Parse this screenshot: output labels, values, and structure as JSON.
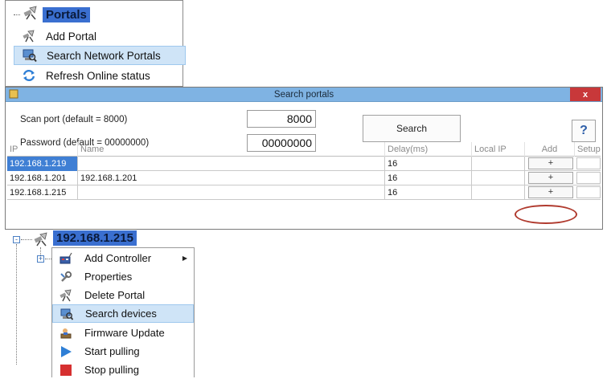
{
  "portals_menu": {
    "title": "Portals",
    "items": [
      {
        "label": "Add Portal",
        "icon": "satellite-icon"
      },
      {
        "label": "Search Network Portals",
        "icon": "search-network-icon"
      },
      {
        "label": "Refresh Online status",
        "icon": "refresh-icon"
      }
    ],
    "highlighted_index": 1
  },
  "dialog": {
    "title": "Search portals",
    "close_label": "x",
    "scan_port_label": "Scan port (default = 8000)",
    "scan_port_value": "8000",
    "password_label": "Password (default = 00000000)",
    "password_value": "00000000",
    "search_button": "Search",
    "help_button": "?",
    "table": {
      "columns": [
        "IP",
        "Name",
        "Delay(ms)",
        "Local IP",
        "Add",
        "Setup"
      ],
      "rows": [
        {
          "ip": "192.168.1.219",
          "name": "",
          "delay": "16",
          "local_ip": "",
          "add": "+",
          "selected": true
        },
        {
          "ip": "192.168.1.201",
          "name": "192.168.1.201",
          "delay": "16",
          "local_ip": "",
          "add": "+",
          "selected": false
        },
        {
          "ip": "192.168.1.215",
          "name": "",
          "delay": "16",
          "local_ip": "",
          "add": "+",
          "selected": false
        }
      ]
    }
  },
  "portal_node": {
    "label": "192.168.1.215",
    "expander_symbol": "-",
    "child_expander_symbol": "+",
    "submenu_arrow": "▶"
  },
  "context_menu": {
    "items": [
      {
        "label": "Add Controller",
        "icon": "add-controller-icon",
        "has_submenu": true
      },
      {
        "label": "Properties",
        "icon": "properties-icon"
      },
      {
        "label": "Delete Portal",
        "icon": "delete-portal-icon"
      },
      {
        "label": "Search devices",
        "icon": "search-devices-icon"
      },
      {
        "label": "Firmware Update",
        "icon": "firmware-update-icon"
      },
      {
        "label": "Start pulling",
        "icon": "play-icon"
      },
      {
        "label": "Stop pulling",
        "icon": "stop-icon"
      }
    ],
    "highlighted_index": 3
  },
  "colors": {
    "selection_blue": "#3a6fd0",
    "menu_highlight": "#cfe4f7",
    "titlebar": "#7fb3e3",
    "close_red": "#c8383a",
    "annotation_red": "#b03a2e"
  }
}
